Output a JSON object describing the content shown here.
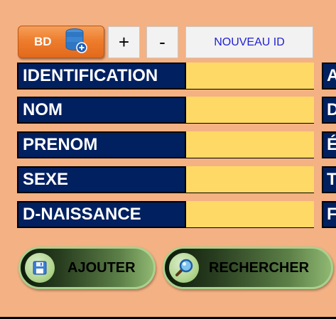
{
  "toolbar": {
    "db_button_label": "BD",
    "db_icon": "database-add-icon",
    "plus_label": "+",
    "minus_label": "-",
    "new_id_label": "NOUVEAU ID"
  },
  "form": {
    "rows": [
      {
        "label": "IDENTIFICATION",
        "value": "",
        "right_label": "A"
      },
      {
        "label": "NOM",
        "value": "",
        "right_label": "D"
      },
      {
        "label": "PRENOM",
        "value": "",
        "right_label": "É"
      },
      {
        "label": "SEXE",
        "value": "",
        "right_label": "T"
      },
      {
        "label": "D-NAISSANCE",
        "value": "",
        "right_label": "F"
      }
    ]
  },
  "actions": {
    "add_label": "AJOUTER",
    "add_icon": "save-icon",
    "search_label": "RECHERCHER",
    "search_icon": "magnifier-icon"
  },
  "colors": {
    "background": "#f4b183",
    "label_bg": "#002060",
    "field_bg": "#ffd966",
    "db_button": "#ee7d2d",
    "new_id_text": "#1f1fd4",
    "pill_border": "#a9d18e"
  }
}
